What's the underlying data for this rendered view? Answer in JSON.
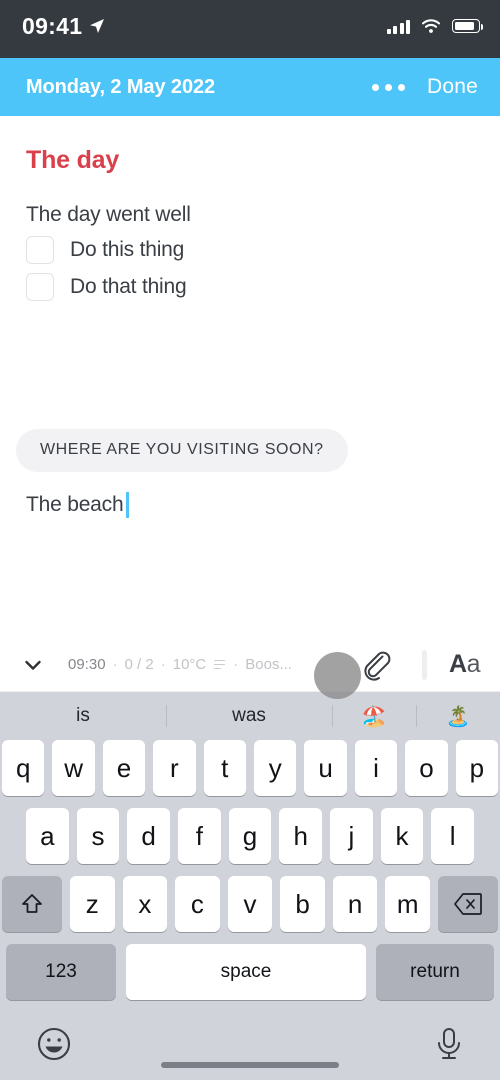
{
  "status_bar": {
    "time": "09:41",
    "location_icon": "location-arrow-icon",
    "signal_icon": "cellular-signal-icon",
    "wifi_icon": "wifi-icon",
    "battery_icon": "battery-icon"
  },
  "nav_bar": {
    "title": "Monday, 2 May 2022",
    "more_icon": "more-options-icon",
    "done_label": "Done",
    "background_color": "#4ec5f8"
  },
  "note": {
    "heading": "The day",
    "heading_color": "#d9404b",
    "body_line": "The day went well",
    "todos": [
      {
        "label": "Do this thing",
        "checked": false
      },
      {
        "label": "Do that thing",
        "checked": false
      }
    ],
    "prompt_bubble": "WHERE ARE YOU VISITING SOON?",
    "answer_text": "The beach",
    "caret_color": "#4ec5f8"
  },
  "toolbar": {
    "collapse_icon": "chevron-down-icon",
    "meta": {
      "time": "09:30",
      "sep1": "·",
      "todo_count": "0 / 2",
      "sep2": "·",
      "temperature": "10°C",
      "weather_icon": "haze-lines-icon",
      "sep3": "·",
      "music": "Boos..."
    },
    "attach_icon": "paperclip-icon",
    "format_label_bold": "A",
    "format_label_plain": "a",
    "tap_indicator": "touch-indicator"
  },
  "keyboard": {
    "suggestions": [
      {
        "text": "is",
        "type": "word"
      },
      {
        "text": "was",
        "type": "word"
      },
      {
        "text": "🏖️",
        "type": "emoji"
      },
      {
        "text": "🏝️",
        "type": "emoji"
      }
    ],
    "row1": [
      "q",
      "w",
      "e",
      "r",
      "t",
      "y",
      "u",
      "i",
      "o",
      "p"
    ],
    "row2": [
      "a",
      "s",
      "d",
      "f",
      "g",
      "h",
      "j",
      "k",
      "l"
    ],
    "row3": [
      "z",
      "x",
      "c",
      "v",
      "b",
      "n",
      "m"
    ],
    "shift_icon": "shift-up-arrow-icon",
    "backspace_icon": "backspace-delete-icon",
    "numbers_label": "123",
    "space_label": "space",
    "return_label": "return",
    "emoji_icon": "smiley-face-icon",
    "mic_icon": "microphone-icon",
    "background_color": "#d1d3da"
  }
}
